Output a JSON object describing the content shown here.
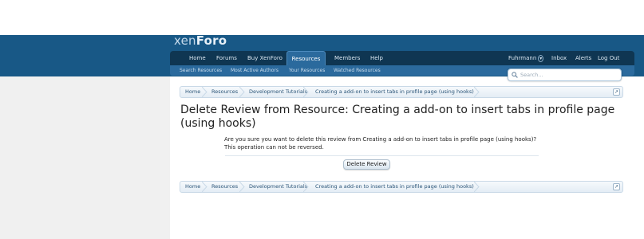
{
  "logo": {
    "part1": "xen",
    "part2": "Foro"
  },
  "nav": {
    "items": [
      "Home",
      "Forums",
      "Buy XenForo",
      "Resources",
      "Members",
      "Help"
    ],
    "active": "Resources",
    "user": "Fuhrmann",
    "inbox": "Inbox",
    "alerts": "Alerts",
    "logout": "Log Out"
  },
  "subnav": {
    "items": [
      "Search Resources",
      "Most Active Authors",
      "Your Resources",
      "Watched Resources"
    ]
  },
  "search": {
    "placeholder": "Search..."
  },
  "breadcrumb": {
    "items": [
      "Home",
      "Resources",
      "Development Tutorials",
      "Creating a add-on to insert tabs in profile page (using hooks)"
    ]
  },
  "page": {
    "title": "Delete Review from Resource: Creating a add-on to insert tabs in profile page (using hooks)",
    "message_line1": "Are you sure you want to delete this review from Creating a add-on to insert tabs in profile page (using hooks)?",
    "message_line2": "This operation can not be reversed.",
    "delete_button": "Delete Review"
  }
}
